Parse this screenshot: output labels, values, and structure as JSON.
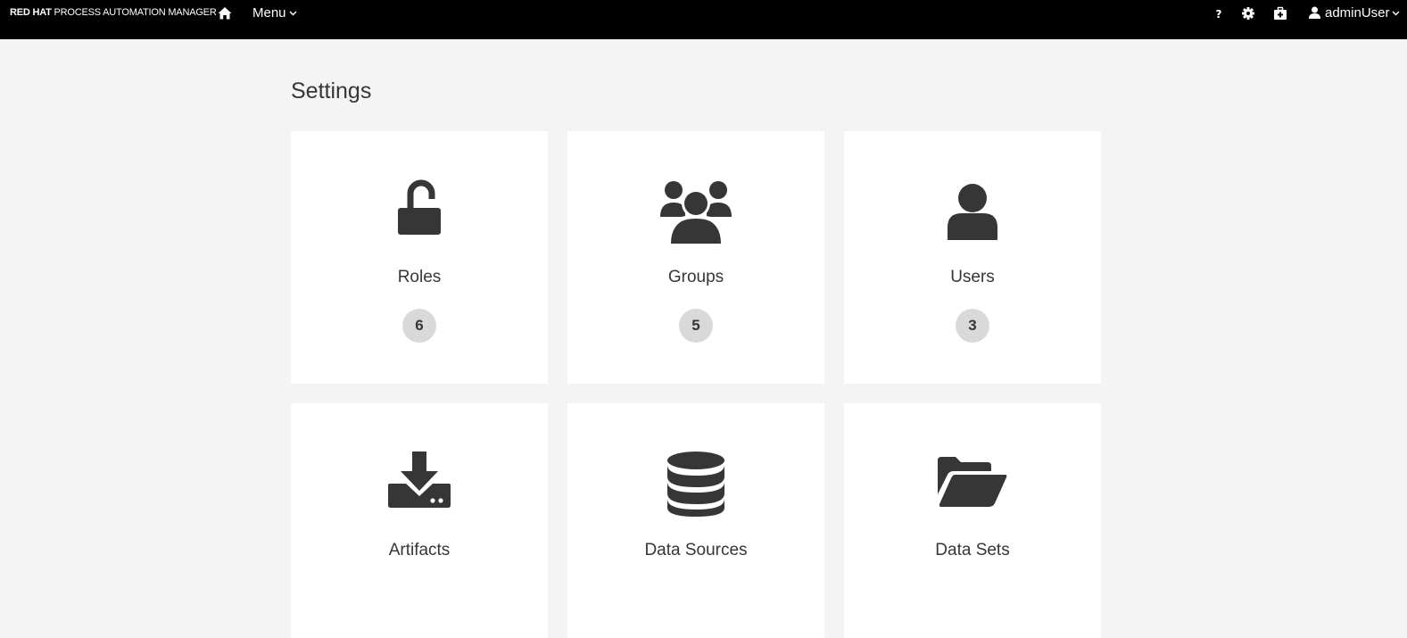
{
  "navbar": {
    "brand_bold": "RED HAT",
    "brand_rest": "PROCESS AUTOMATION MANAGER",
    "menu_label": "Menu",
    "user_label": "adminUser",
    "icons": [
      "home-icon",
      "help-icon",
      "gear-icon",
      "first-aid-kit-icon",
      "user-icon"
    ]
  },
  "page": {
    "title": "Settings"
  },
  "cards": [
    {
      "label": "Roles",
      "count": "6",
      "icon": "unlock-icon"
    },
    {
      "label": "Groups",
      "count": "5",
      "icon": "users-group-icon"
    },
    {
      "label": "Users",
      "count": "3",
      "icon": "user-icon"
    },
    {
      "label": "Artifacts",
      "icon": "download-tray-icon"
    },
    {
      "label": "Data Sources",
      "icon": "database-icon"
    },
    {
      "label": "Data Sets",
      "icon": "folder-open-icon"
    }
  ],
  "colors": {
    "navbar_bg": "#000000",
    "page_bg": "#f4f4f4",
    "card_bg": "#ffffff",
    "icon": "#363636",
    "badge_bg": "#d9d9d9"
  }
}
